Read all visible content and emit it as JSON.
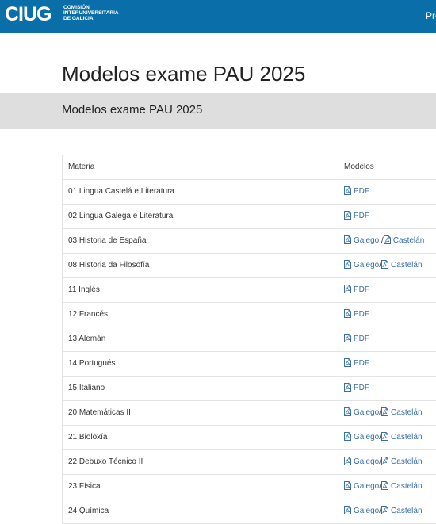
{
  "header": {
    "logo_mark": "CIUG",
    "logo_lines": [
      "COMISIÓN",
      "INTERUNIVERSITARIA",
      "DE GALICIA"
    ],
    "nav_partial": "Pre"
  },
  "page": {
    "title": "Modelos exame PAU 2025",
    "section_title": "Modelos exame PAU 2025"
  },
  "table": {
    "headers": {
      "materia": "Materia",
      "modelos": "Modelos"
    },
    "rows": [
      {
        "materia": "01 Lingua Castelá e Literatura",
        "links": [
          "PDF"
        ],
        "sep": ""
      },
      {
        "materia": "02 Lingua Galega e Literatura",
        "links": [
          "PDF"
        ],
        "sep": ""
      },
      {
        "materia": "03 Historia de España",
        "links": [
          "Galego",
          "Castelán"
        ],
        "sep": " /"
      },
      {
        "materia": "08 Historia da Filosofía",
        "links": [
          "Galego",
          "Castelán"
        ],
        "sep": "/"
      },
      {
        "materia": "11 Inglés",
        "links": [
          "PDF"
        ],
        "sep": ""
      },
      {
        "materia": "12 Francés",
        "links": [
          "PDF"
        ],
        "sep": ""
      },
      {
        "materia": "13 Alemán",
        "links": [
          "PDF"
        ],
        "sep": ""
      },
      {
        "materia": "14 Portugués",
        "links": [
          "PDF"
        ],
        "sep": ""
      },
      {
        "materia": "15 Italiano",
        "links": [
          "PDF"
        ],
        "sep": ""
      },
      {
        "materia": "20 Matemáticas II",
        "links": [
          "Galego",
          "Castelán"
        ],
        "sep": "/"
      },
      {
        "materia": "21 Bioloxía",
        "links": [
          "Galego",
          "Castelán"
        ],
        "sep": "/"
      },
      {
        "materia": "22 Debuxo Técnico II",
        "links": [
          "Galego",
          "Castelán"
        ],
        "sep": "/"
      },
      {
        "materia": "23 Física",
        "links": [
          "Galego",
          "Castelán"
        ],
        "sep": "/"
      },
      {
        "materia": "24 Química",
        "links": [
          "Galego",
          "Castelán"
        ],
        "sep": "/"
      }
    ]
  },
  "colors": {
    "header_bg": "#0a6ea8",
    "band_bg": "#dedede",
    "link": "#3a6fa8"
  },
  "icons": {
    "file": "pdf-file-icon"
  }
}
